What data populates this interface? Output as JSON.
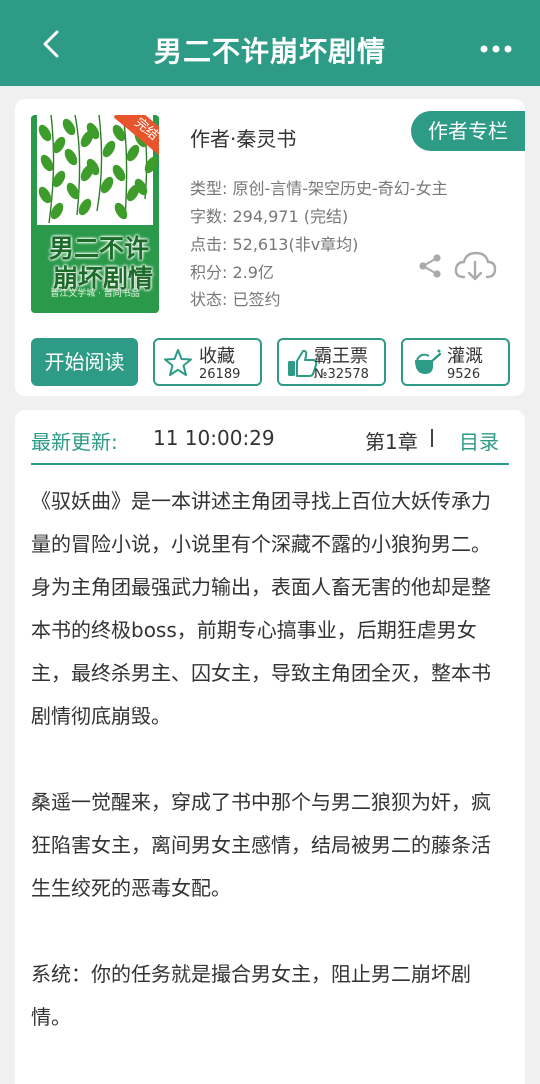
{
  "header": {
    "title": "男二不许崩坏剧情",
    "back_icon": "chevron-left-icon",
    "more_icon": "more-dots-icon",
    "background": "#2e9b86"
  },
  "book": {
    "cover": {
      "badge": "完结",
      "title_line1": "男二不许",
      "title_line2": "崩坏剧情",
      "publisher": "晋江文学城 · 晋同书品"
    },
    "author_line": "作者·秦灵书",
    "author_column_label": "作者专栏",
    "meta": {
      "type": "类型: 原创-言情-架空历史-奇幻-女主",
      "words": "字数: 294,971 (完结)",
      "clicks": "点击: 52,613(非v章均)",
      "score": "积分: 2.9亿",
      "status": "状态: 已签约"
    },
    "share_icon": "share-icon",
    "download_icon": "cloud-download-icon"
  },
  "actions": {
    "read_label": "开始阅读",
    "favorite": {
      "label": "收藏",
      "count": "26189",
      "icon": "star-icon"
    },
    "bawang": {
      "label": "霸王票",
      "count": "№32578",
      "icon": "thumbs-up-icon"
    },
    "irrigate": {
      "label": "灌溉",
      "count": "9526",
      "icon": "watering-can-icon"
    }
  },
  "update": {
    "label": "最新更新:",
    "time": "11 10:00:29",
    "chapter": "第1章",
    "toc_label": "目录"
  },
  "intro": {
    "p1": "《驭妖曲》是一本讲述主角团寻找上百位大妖传承力量的冒险小说，小说里有个深藏不露的小狼狗男二。",
    "p2": "身为主角团最强武力输出，表面人畜无害的他却是整本书的终极boss，前期专心搞事业，后期狂虐男女主，最终杀男主、囚女主，导致主角团全灭，整本书剧情彻底崩毁。",
    "p3": "桑遥一觉醒来，穿成了书中那个与男二狼狈为奸，疯狂陷害女主，离间男女主感情，结局被男二的藤条活生生绞死的恶毒女配。",
    "p4": "系统：你的任务就是撮合男女主，阻止男二崩坏剧情。"
  },
  "theme": {
    "accent": "#2e9b86",
    "cover_green": "#2a9a4a",
    "badge_orange": "#e8542b"
  }
}
